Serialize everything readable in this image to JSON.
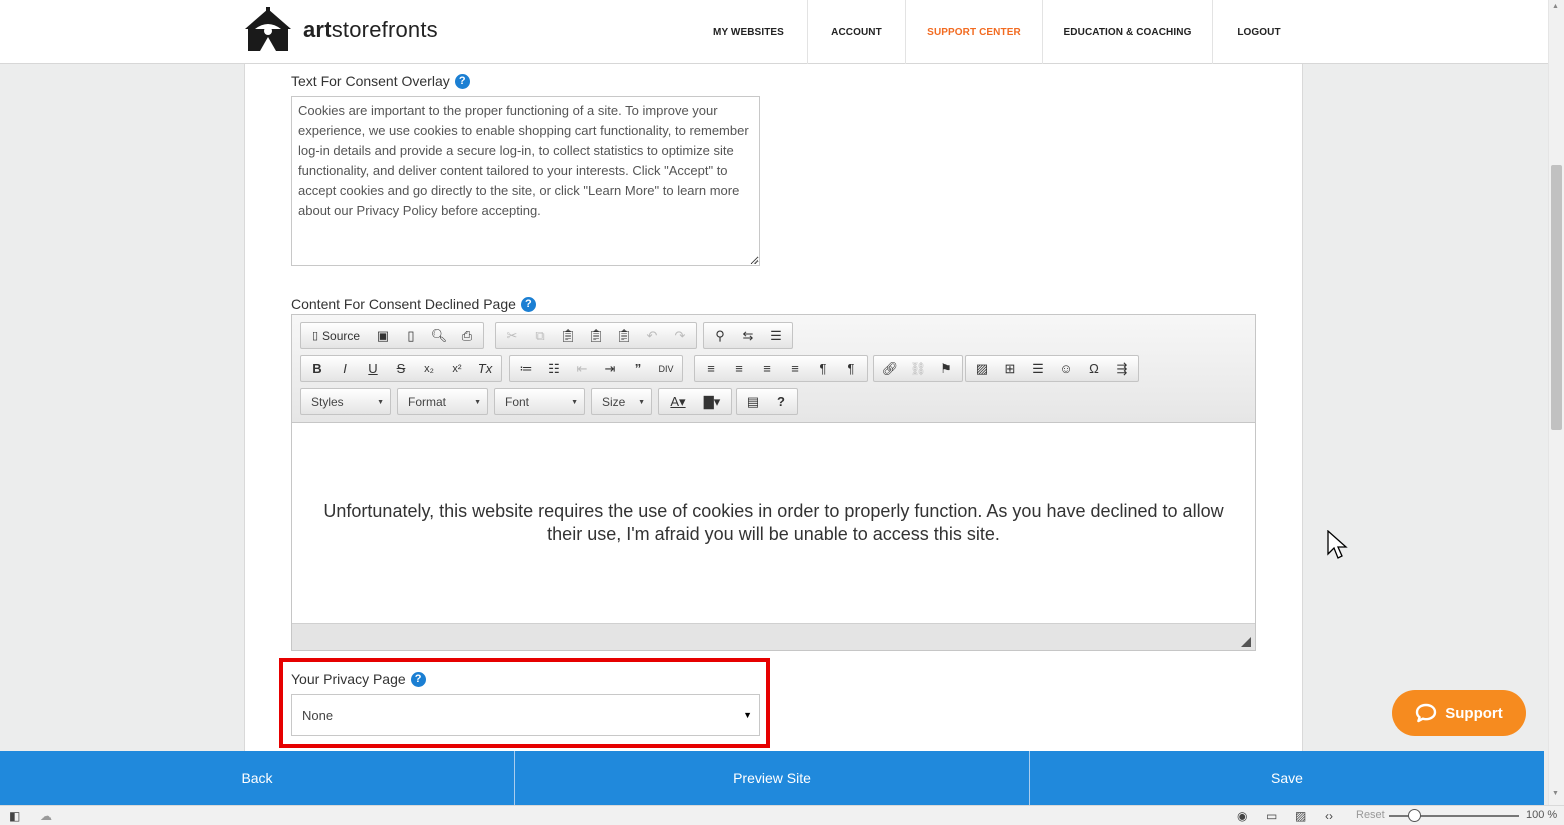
{
  "header": {
    "logo_bold": "art",
    "logo_rest": "storefronts",
    "nav": [
      {
        "label": "MY WEBSITES"
      },
      {
        "label": "ACCOUNT"
      },
      {
        "label": "SUPPORT CENTER"
      },
      {
        "label": "EDUCATION & COACHING"
      },
      {
        "label": "LOGOUT"
      }
    ],
    "active_color": "#f26b21"
  },
  "consent_overlay": {
    "label": "Text For Consent Overlay",
    "help": "?",
    "text": "Cookies are important to the proper functioning of a site. To improve your experience, we use cookies to enable shopping cart functionality, to remember log-in details and provide a secure log-in, to collect statistics to optimize site functionality, and deliver content tailored to your interests. Click \"Accept\" to accept cookies and go directly to the site, or click \"Learn More\" to learn more about our Privacy Policy before accepting."
  },
  "declined_page": {
    "label": "Content For Consent Declined Page",
    "help": "?",
    "toolbar": {
      "source_label": "Source",
      "combos": [
        "Styles",
        "Format",
        "Font",
        "Size"
      ]
    },
    "content": "Unfortunately, this website requires the use of cookies in order to properly function. As you have declined to allow their use, I'm afraid you will be unable to access this site."
  },
  "privacy": {
    "label": "Your Privacy Page",
    "help": "?",
    "selected": "None"
  },
  "bottom_bar": {
    "back": "Back",
    "preview": "Preview Site",
    "save": "Save",
    "color": "#2089dc"
  },
  "support": {
    "label": "Support",
    "color": "#f68b1f"
  },
  "statusbar": {
    "reset": "Reset",
    "zoom": "100 %"
  }
}
